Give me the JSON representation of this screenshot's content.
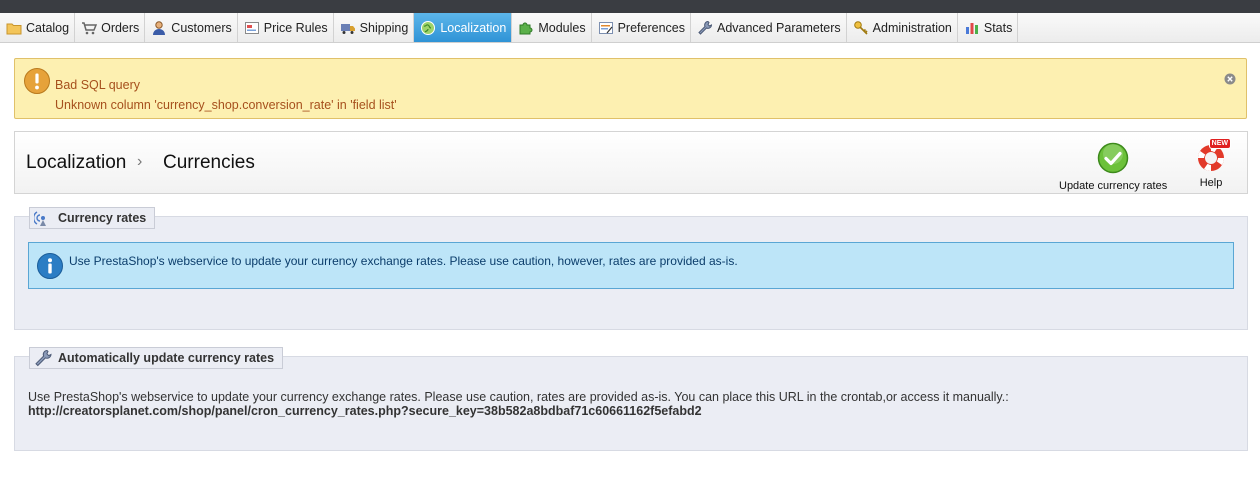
{
  "nav": {
    "items": [
      {
        "label": "Catalog",
        "icon": "folder-icon"
      },
      {
        "label": "Orders",
        "icon": "cart-icon"
      },
      {
        "label": "Customers",
        "icon": "user-icon"
      },
      {
        "label": "Price Rules",
        "icon": "price-tag-icon"
      },
      {
        "label": "Shipping",
        "icon": "truck-icon"
      },
      {
        "label": "Localization",
        "icon": "globe-icon"
      },
      {
        "label": "Modules",
        "icon": "puzzle-icon"
      },
      {
        "label": "Preferences",
        "icon": "form-icon"
      },
      {
        "label": "Advanced Parameters",
        "icon": "wrench-icon"
      },
      {
        "label": "Administration",
        "icon": "key-icon"
      },
      {
        "label": "Stats",
        "icon": "bar-chart-icon"
      }
    ],
    "active": "Localization"
  },
  "alert": {
    "title": "Bad SQL query",
    "message": "Unknown column 'currency_shop.conversion_rate' in 'field list'"
  },
  "breadcrumb": {
    "parent": "Localization",
    "separator": "›",
    "current": "Currencies"
  },
  "toolbar": {
    "update_label": "Update currency rates",
    "help_label": "Help",
    "help_badge": "NEW"
  },
  "currency_rates": {
    "legend": "Currency rates",
    "info": "Use PrestaShop's webservice to update your currency exchange rates. Please use caution, however, rates are provided as-is."
  },
  "auto_update": {
    "legend": "Automatically update currency rates",
    "text": "Use PrestaShop's webservice to update your currency exchange rates. Please use caution, rates are provided as-is. You can place this URL in the crontab,or access it manually.:",
    "url": "http://creatorsplanet.com/shop/panel/cron_currency_rates.php?secure_key=38b582a8bdbaf71c60661162f5efabd2"
  },
  "colors": {
    "active_tab": "#2f93d6",
    "alert_bg": "#fdf0b1",
    "alert_text": "#a6501d",
    "info_bg": "#bde5f8",
    "fieldset_bg": "#ebedf4"
  }
}
